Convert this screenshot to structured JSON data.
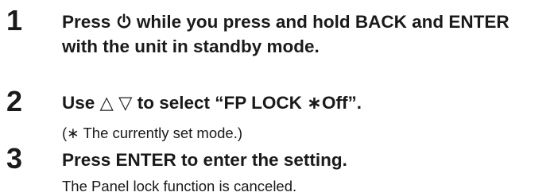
{
  "steps": [
    {
      "number": "1",
      "text_a": "Press",
      "icon": "power-icon",
      "text_b": "while you press and hold BACK and ENTER",
      "line2": "with the unit in standby mode."
    },
    {
      "number": "2",
      "text_a": "Use",
      "up_symbol": "△",
      "down_symbol": "▽",
      "text_b": "to select “FP LOCK",
      "star": "∗",
      "text_c": "Off”.",
      "note_open": "(",
      "note_star": "∗",
      "note_text": "The currently set mode.)"
    },
    {
      "number": "3",
      "text": "Press ENTER to enter the setting.",
      "note": "The Panel lock function is canceled."
    }
  ]
}
